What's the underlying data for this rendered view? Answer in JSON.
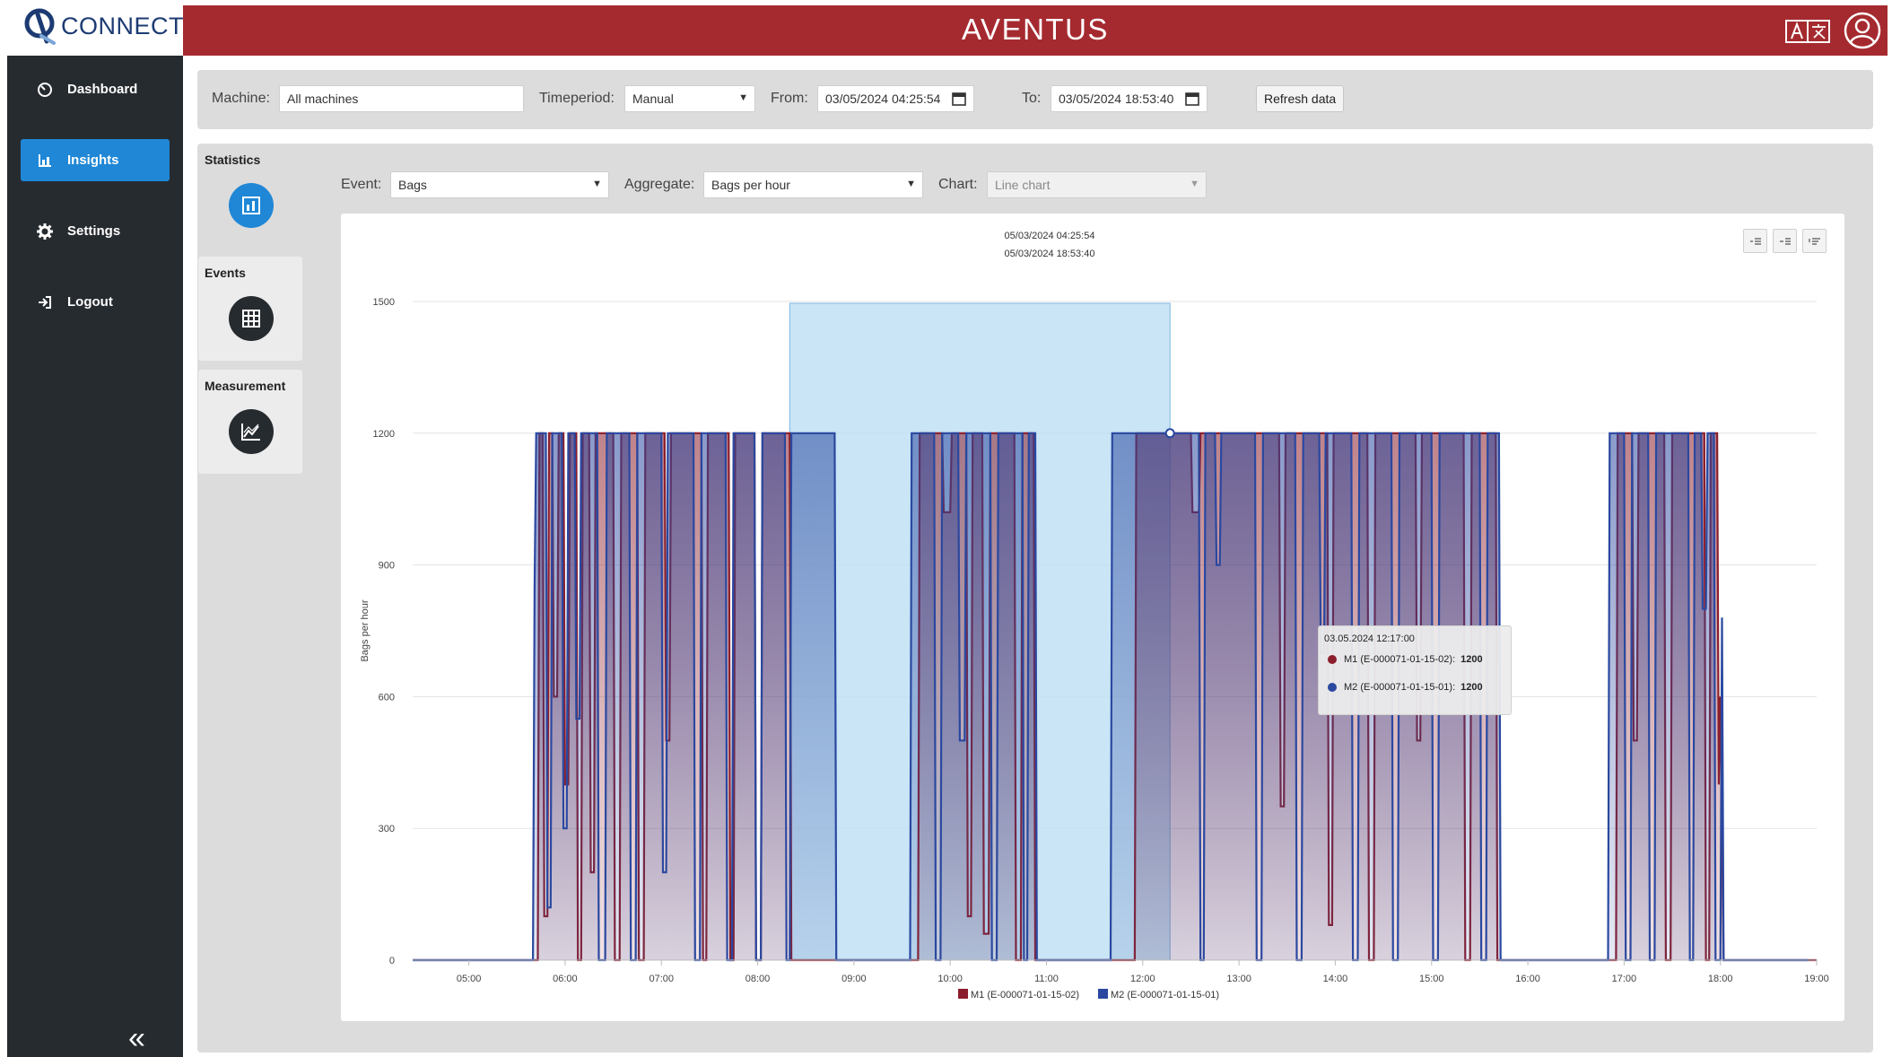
{
  "brand": {
    "name": "CONNECT"
  },
  "header": {
    "logo_text": "AVENTUS"
  },
  "sidebar": {
    "items": [
      {
        "label": "Dashboard",
        "icon": "dashboard-icon"
      },
      {
        "label": "Insights",
        "icon": "bar-chart-icon",
        "active": true
      },
      {
        "label": "Settings",
        "icon": "gear-icon"
      },
      {
        "label": "Logout",
        "icon": "logout-icon"
      }
    ],
    "collapse_icon": "«"
  },
  "filters": {
    "machine_label": "Machine:",
    "machine_value": "All machines",
    "timeperiod_label": "Timeperiod:",
    "timeperiod_value": "Manual",
    "from_label": "From:",
    "from_value": "03/05/2024 04:25:54",
    "to_label": "To:",
    "to_value": "03/05/2024 18:53:40",
    "refresh_label": "Refresh data"
  },
  "tabs": [
    {
      "label": "Statistics",
      "icon": "statistics-icon"
    },
    {
      "label": "Events",
      "icon": "table-icon"
    },
    {
      "label": "Measurement",
      "icon": "measurement-icon"
    }
  ],
  "controls": {
    "event_label": "Event:",
    "event_value": "Bags",
    "aggregate_label": "Aggregate:",
    "aggregate_value": "Bags per hour",
    "chart_label": "Chart:",
    "chart_value": "Line chart"
  },
  "colors": {
    "header": "#a52a2f",
    "sidebar": "#262b30",
    "accent": "#1f87d6",
    "m1": "#8b1e2c",
    "m2": "#2a48a0",
    "selection": "#bfe0f5"
  },
  "chart_data": {
    "type": "line",
    "title_lines": [
      "05/03/2024 04:25:54",
      "05/03/2024 18:53:40"
    ],
    "ylabel": "Bags per hour",
    "ylim": [
      0,
      1500
    ],
    "yticks": [
      0,
      300,
      600,
      900,
      1200,
      1500
    ],
    "xlim": [
      "04:25",
      "19:00"
    ],
    "xticks": [
      "05:00",
      "06:00",
      "07:00",
      "08:00",
      "09:00",
      "10:00",
      "11:00",
      "12:00",
      "13:00",
      "14:00",
      "15:00",
      "16:00",
      "17:00",
      "18:00",
      "19:00"
    ],
    "selection": {
      "from": "08:20",
      "to": "12:17"
    },
    "series": [
      {
        "name": "M1 (E-000071-01-15-02)",
        "points": [
          [
            "04:25",
            0
          ],
          [
            "05:43",
            0
          ],
          [
            "05:44",
            1200
          ],
          [
            "05:46",
            1200
          ],
          [
            "05:47",
            100
          ],
          [
            "05:49",
            100
          ],
          [
            "05:50",
            1200
          ],
          [
            "05:52",
            1200
          ],
          [
            "05:53",
            600
          ],
          [
            "05:55",
            600
          ],
          [
            "05:56",
            1200
          ],
          [
            "05:59",
            1200
          ],
          [
            "06:00",
            400
          ],
          [
            "06:02",
            400
          ],
          [
            "06:03",
            1200
          ],
          [
            "06:07",
            1200
          ],
          [
            "06:08",
            0
          ],
          [
            "06:10",
            0
          ],
          [
            "06:11",
            1200
          ],
          [
            "06:15",
            1200
          ],
          [
            "06:16",
            200
          ],
          [
            "06:18",
            200
          ],
          [
            "06:19",
            1200
          ],
          [
            "06:30",
            1200
          ],
          [
            "06:31",
            0
          ],
          [
            "06:34",
            0
          ],
          [
            "06:35",
            1200
          ],
          [
            "06:45",
            1200
          ],
          [
            "06:46",
            0
          ],
          [
            "06:49",
            0
          ],
          [
            "06:50",
            1200
          ],
          [
            "07:02",
            1200
          ],
          [
            "07:03",
            500
          ],
          [
            "07:05",
            500
          ],
          [
            "07:06",
            1200
          ],
          [
            "07:25",
            1200
          ],
          [
            "07:26",
            0
          ],
          [
            "07:28",
            0
          ],
          [
            "07:29",
            1200
          ],
          [
            "07:42",
            1200
          ],
          [
            "07:43",
            0
          ],
          [
            "07:45",
            0
          ],
          [
            "07:46",
            1200
          ],
          [
            "07:58",
            1200
          ],
          [
            "07:59",
            0
          ],
          [
            "08:02",
            0
          ],
          [
            "08:03",
            1200
          ],
          [
            "08:20",
            1200
          ],
          [
            "08:21",
            0
          ],
          [
            "09:40",
            0
          ],
          [
            "09:41",
            1200
          ],
          [
            "09:55",
            1200
          ],
          [
            "09:56",
            1020
          ],
          [
            "10:00",
            1020
          ],
          [
            "10:01",
            1200
          ],
          [
            "10:10",
            1200
          ],
          [
            "10:11",
            100
          ],
          [
            "10:13",
            100
          ],
          [
            "10:14",
            1200
          ],
          [
            "10:20",
            1200
          ],
          [
            "10:21",
            60
          ],
          [
            "10:24",
            60
          ],
          [
            "10:25",
            1200
          ],
          [
            "10:40",
            1200
          ],
          [
            "10:41",
            0
          ],
          [
            "10:44",
            0
          ],
          [
            "10:45",
            1200
          ],
          [
            "10:52",
            1200
          ],
          [
            "10:53",
            0
          ],
          [
            "11:55",
            0
          ],
          [
            "11:56",
            1200
          ],
          [
            "12:30",
            1200
          ],
          [
            "12:31",
            1020
          ],
          [
            "12:35",
            1020
          ],
          [
            "12:36",
            1200
          ],
          [
            "12:50",
            1200
          ],
          [
            "12:51",
            1200
          ],
          [
            "13:25",
            1200
          ],
          [
            "13:26",
            350
          ],
          [
            "13:28",
            350
          ],
          [
            "13:29",
            1200
          ],
          [
            "13:55",
            1200
          ],
          [
            "13:56",
            80
          ],
          [
            "13:58",
            80
          ],
          [
            "13:59",
            1200
          ],
          [
            "14:20",
            1200
          ],
          [
            "14:21",
            0
          ],
          [
            "14:24",
            0
          ],
          [
            "14:25",
            1200
          ],
          [
            "14:50",
            1200
          ],
          [
            "14:51",
            500
          ],
          [
            "14:53",
            500
          ],
          [
            "14:54",
            1200
          ],
          [
            "15:20",
            1200
          ],
          [
            "15:21",
            0
          ],
          [
            "15:24",
            0
          ],
          [
            "15:25",
            1200
          ],
          [
            "15:40",
            1200
          ],
          [
            "15:41",
            0
          ],
          [
            "16:55",
            0
          ],
          [
            "16:56",
            1200
          ],
          [
            "17:05",
            1200
          ],
          [
            "17:06",
            500
          ],
          [
            "17:08",
            500
          ],
          [
            "17:09",
            1200
          ],
          [
            "17:25",
            1200
          ],
          [
            "17:26",
            0
          ],
          [
            "17:29",
            0
          ],
          [
            "17:30",
            1200
          ],
          [
            "17:50",
            1200
          ],
          [
            "17:51",
            0
          ],
          [
            "17:53",
            0
          ],
          [
            "17:54",
            1200
          ],
          [
            "17:58",
            1200
          ],
          [
            "17:59",
            400
          ],
          [
            "18:00",
            600
          ],
          [
            "18:02",
            0
          ],
          [
            "19:00",
            0
          ]
        ]
      },
      {
        "name": "M2 (E-000071-01-15-01)",
        "points": [
          [
            "04:25",
            0
          ],
          [
            "05:40",
            0
          ],
          [
            "05:41",
            850
          ],
          [
            "05:42",
            1200
          ],
          [
            "05:48",
            1200
          ],
          [
            "05:49",
            120
          ],
          [
            "05:51",
            120
          ],
          [
            "05:52",
            1200
          ],
          [
            "05:58",
            1200
          ],
          [
            "05:59",
            300
          ],
          [
            "06:01",
            300
          ],
          [
            "06:02",
            1200
          ],
          [
            "06:06",
            1200
          ],
          [
            "06:07",
            550
          ],
          [
            "06:09",
            550
          ],
          [
            "06:10",
            1200
          ],
          [
            "06:20",
            1200
          ],
          [
            "06:21",
            0
          ],
          [
            "06:25",
            0
          ],
          [
            "06:26",
            1200
          ],
          [
            "06:40",
            1200
          ],
          [
            "06:41",
            0
          ],
          [
            "06:44",
            0
          ],
          [
            "06:45",
            1200
          ],
          [
            "07:00",
            1200
          ],
          [
            "07:01",
            200
          ],
          [
            "07:03",
            200
          ],
          [
            "07:04",
            1200
          ],
          [
            "07:20",
            1200
          ],
          [
            "07:21",
            0
          ],
          [
            "07:24",
            0
          ],
          [
            "07:25",
            1200
          ],
          [
            "07:40",
            1200
          ],
          [
            "07:41",
            0
          ],
          [
            "07:44",
            0
          ],
          [
            "07:45",
            1200
          ],
          [
            "07:58",
            1200
          ],
          [
            "07:59",
            0
          ],
          [
            "08:02",
            0
          ],
          [
            "08:03",
            1200
          ],
          [
            "08:17",
            1200
          ],
          [
            "08:18",
            0
          ],
          [
            "08:20",
            0
          ],
          [
            "08:21",
            1200
          ],
          [
            "08:48",
            1200
          ],
          [
            "08:49",
            0
          ],
          [
            "09:35",
            0
          ],
          [
            "09:36",
            1200
          ],
          [
            "09:50",
            1200
          ],
          [
            "09:51",
            0
          ],
          [
            "09:54",
            0
          ],
          [
            "09:55",
            1200
          ],
          [
            "10:05",
            1200
          ],
          [
            "10:06",
            500
          ],
          [
            "10:09",
            500
          ],
          [
            "10:10",
            1200
          ],
          [
            "10:25",
            1200
          ],
          [
            "10:26",
            0
          ],
          [
            "10:29",
            0
          ],
          [
            "10:30",
            1200
          ],
          [
            "10:45",
            1200
          ],
          [
            "10:46",
            0
          ],
          [
            "10:48",
            0
          ],
          [
            "10:49",
            1200
          ],
          [
            "10:53",
            1200
          ],
          [
            "10:54",
            0
          ],
          [
            "11:40",
            0
          ],
          [
            "11:41",
            1200
          ],
          [
            "12:18",
            1200
          ],
          [
            "12:19",
            1200
          ],
          [
            "12:35",
            1200
          ],
          [
            "12:36",
            0
          ],
          [
            "12:38",
            0
          ],
          [
            "12:39",
            1200
          ],
          [
            "12:45",
            1200
          ],
          [
            "12:46",
            900
          ],
          [
            "12:48",
            900
          ],
          [
            "12:49",
            1200
          ],
          [
            "13:10",
            1200
          ],
          [
            "13:11",
            0
          ],
          [
            "13:14",
            0
          ],
          [
            "13:15",
            1200
          ],
          [
            "13:35",
            1200
          ],
          [
            "13:36",
            0
          ],
          [
            "13:39",
            0
          ],
          [
            "13:40",
            1200
          ],
          [
            "13:50",
            1200
          ],
          [
            "13:51",
            700
          ],
          [
            "13:53",
            700
          ],
          [
            "13:54",
            1200
          ],
          [
            "14:10",
            1200
          ],
          [
            "14:11",
            0
          ],
          [
            "14:14",
            0
          ],
          [
            "14:15",
            1200
          ],
          [
            "14:35",
            1200
          ],
          [
            "14:36",
            0
          ],
          [
            "14:39",
            0
          ],
          [
            "14:40",
            1200
          ],
          [
            "15:00",
            1200
          ],
          [
            "15:01",
            0
          ],
          [
            "15:04",
            0
          ],
          [
            "15:05",
            1200
          ],
          [
            "15:30",
            1200
          ],
          [
            "15:31",
            0
          ],
          [
            "15:34",
            0
          ],
          [
            "15:35",
            1200
          ],
          [
            "15:42",
            1200
          ],
          [
            "15:43",
            0
          ],
          [
            "16:50",
            0
          ],
          [
            "16:51",
            1200
          ],
          [
            "17:00",
            1200
          ],
          [
            "17:01",
            0
          ],
          [
            "17:04",
            0
          ],
          [
            "17:05",
            1200
          ],
          [
            "17:15",
            1200
          ],
          [
            "17:16",
            0
          ],
          [
            "17:19",
            0
          ],
          [
            "17:20",
            1200
          ],
          [
            "17:40",
            1200
          ],
          [
            "17:41",
            0
          ],
          [
            "17:43",
            0
          ],
          [
            "17:44",
            1200
          ],
          [
            "17:48",
            1200
          ],
          [
            "17:49",
            800
          ],
          [
            "17:51",
            800
          ],
          [
            "17:52",
            1200
          ],
          [
            "17:56",
            1200
          ],
          [
            "17:57",
            0
          ],
          [
            "18:00",
            0
          ],
          [
            "18:01",
            780
          ],
          [
            "18:02",
            0
          ],
          [
            "18:55",
            0
          ]
        ]
      }
    ],
    "tooltip": {
      "time": "03.05.2024 12:17:00",
      "rows": [
        {
          "series": "M1 (E-000071-01-15-02)",
          "value": 1200
        },
        {
          "series": "M2 (E-000071-01-15-01)",
          "value": 1200
        }
      ]
    },
    "legend_position": "bottom-center",
    "grid": true
  }
}
